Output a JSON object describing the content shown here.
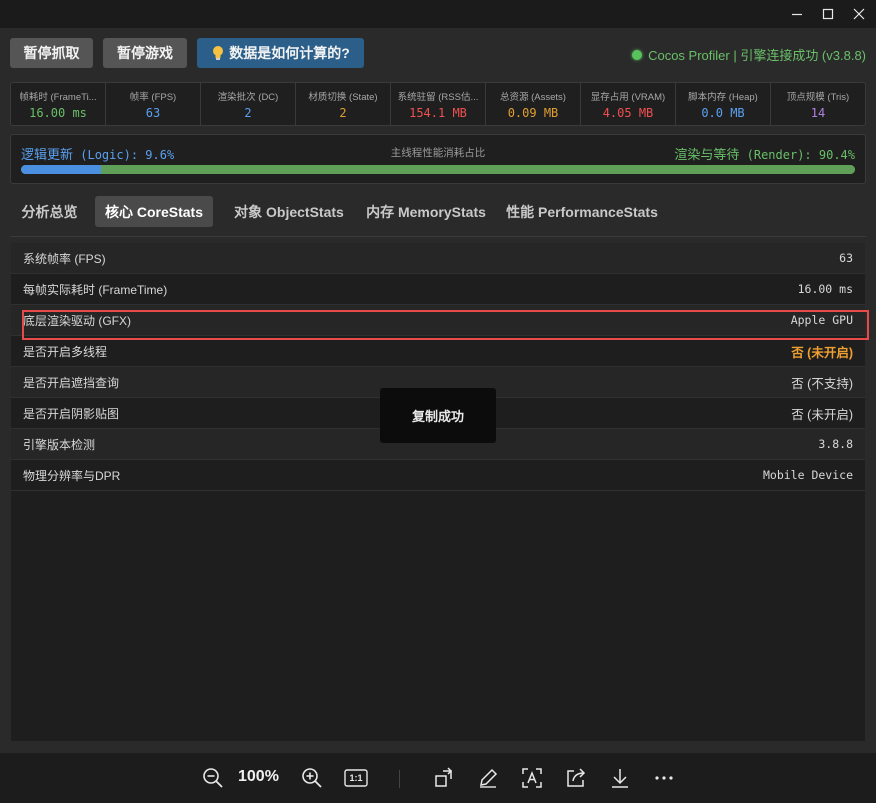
{
  "toolbar": {
    "pause_capture": "暂停抓取",
    "pause_game": "暂停游戏",
    "how_calculated": "数据是如何计算的?",
    "status_text": "Cocos Profiler | 引擎连接成功 (v3.8.8)"
  },
  "stats": [
    {
      "label": "帧耗时 (FrameTi...",
      "value": "16.00 ms",
      "color": "#6abf69"
    },
    {
      "label": "帧率 (FPS)",
      "value": "63",
      "color": "#5aa0f0"
    },
    {
      "label": "渲染批次 (DC)",
      "value": "2",
      "color": "#5aa0f0"
    },
    {
      "label": "材质切换 (State)",
      "value": "2",
      "color": "#e0a030"
    },
    {
      "label": "系统驻留 (RSS估...",
      "value": "154.1 MB",
      "color": "#f05050"
    },
    {
      "label": "总资源 (Assets)",
      "value": "0.09 MB",
      "color": "#e0a030"
    },
    {
      "label": "显存占用 (VRAM)",
      "value": "4.05 MB",
      "color": "#f05050"
    },
    {
      "label": "脚本内存 (Heap)",
      "value": "0.0 MB",
      "color": "#5aa0f0"
    },
    {
      "label": "顶点规模 (Tris)",
      "value": "14",
      "color": "#b080e0"
    }
  ],
  "ratio": {
    "logic_label": "逻辑更新",
    "logic_value": "(Logic): 9.6%",
    "logic_percent": 9.6,
    "middle_text": "主线程性能消耗占比",
    "render_label": "渲染与等待",
    "render_value": "(Render): 90.4%",
    "render_percent": 90.4
  },
  "tabs": [
    "分析总览",
    "核心 CoreStats",
    "对象 ObjectStats",
    "内存 MemoryStats",
    "性能 PerformanceStats"
  ],
  "active_tab": 1,
  "rows": [
    {
      "key": "系统帧率 (FPS)",
      "value": "63"
    },
    {
      "key": "每帧实际耗时 (FrameTime)",
      "value": "16.00 ms"
    },
    {
      "key": "底层渲染驱动 (GFX)",
      "value": "Apple GPU"
    },
    {
      "key": "是否开启多线程",
      "value": "否 (未开启)"
    },
    {
      "key": "是否开启遮挡查询",
      "value": "否 (不支持)"
    },
    {
      "key": "是否开启阴影贴图",
      "value": "否 (未开启)"
    },
    {
      "key": "引擎版本检测",
      "value": "3.8.8"
    },
    {
      "key": "物理分辨率与DPR",
      "value": "Mobile Device"
    }
  ],
  "toast": "复制成功",
  "viewer": {
    "zoom": "100%",
    "actual_size": "1:1"
  }
}
